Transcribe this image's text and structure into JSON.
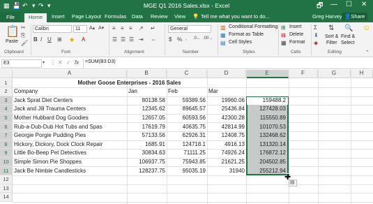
{
  "window": {
    "title": "MGE Q1 2016 Sales.xlsx - Excel",
    "controls": [
      "🗗",
      "—",
      "☐",
      "✕"
    ]
  },
  "tabs": [
    "File",
    "Home",
    "Insert",
    "Page Layout",
    "Formulas",
    "Data",
    "Review",
    "View"
  ],
  "tell_me": "Tell me what you want to do...",
  "user": "Greg Harvey",
  "share": "Share",
  "ribbon": {
    "paste": "Paste",
    "clipboard": "Clipboard",
    "font_name": "Calibri",
    "font_size": "11",
    "font": "Font",
    "alignment": "Alignment",
    "number_format": "General",
    "number": "Number",
    "conditional_formatting": "Conditional Formatting",
    "format_as_table": "Format as Table",
    "cell_styles": "Cell Styles",
    "styles": "Styles",
    "insert": "Insert",
    "delete": "Delete",
    "format": "Format",
    "cells": "Cells",
    "sort_filter_1": "Sort &",
    "sort_filter_2": "Filter",
    "find_select_1": "Find &",
    "find_select_2": "Select",
    "editing": "Editing"
  },
  "formula_bar": {
    "name_box": "E3",
    "fx": "fx",
    "formula": "=SUM(B3:D3)"
  },
  "columns": [
    "A",
    "B",
    "C",
    "D",
    "E",
    "F",
    "G",
    "H"
  ],
  "rows": [
    "1",
    "2",
    "3",
    "4",
    "5",
    "6",
    "7",
    "8",
    "9",
    "10",
    "11",
    "12",
    "13",
    "14"
  ],
  "sheet": {
    "title": "Mother Goose Enterprises - 2016 Sales",
    "headers": [
      "Company",
      "Jan",
      "Feb",
      "Mar"
    ],
    "data": [
      [
        "Jack Sprat Diet Centers",
        "80138.58",
        "59389.56",
        "19960.06",
        "159488.2"
      ],
      [
        "Jack and Jill Trauma Centers",
        "12345.62",
        "89645.57",
        "25436.84",
        "127428.03"
      ],
      [
        "Mother Hubbard Dog Goodies",
        "12657.05",
        "60593.56",
        "42300.28",
        "115550.89"
      ],
      [
        "Rub-a-Dub-Dub Hot Tubs and Spas",
        "17619.79",
        "40635.75",
        "42814.99",
        "101070.53"
      ],
      [
        "Georgie Porgie Pudding Pies",
        "57133.56",
        "62926.31",
        "12408.75",
        "132468.62"
      ],
      [
        "Hickory, Dickory,  Dock Clock Repair",
        "1685.91",
        "124718.1",
        "4916.13",
        "131320.14"
      ],
      [
        "Little Bo-Beep Pet Detectives",
        "30834.63",
        "71111.25",
        "74926.24",
        "176872.12"
      ],
      [
        "Simple Simon Pie Shoppes",
        "106937.75",
        "75943.85",
        "21621.25",
        "204502.85"
      ],
      [
        "Jack Be Nimble Candlesticks",
        "128237.75",
        "95035.19",
        "31940",
        "255212.94"
      ]
    ]
  },
  "selection": {
    "accent": "#217346",
    "fill": "#c6cbc9"
  }
}
